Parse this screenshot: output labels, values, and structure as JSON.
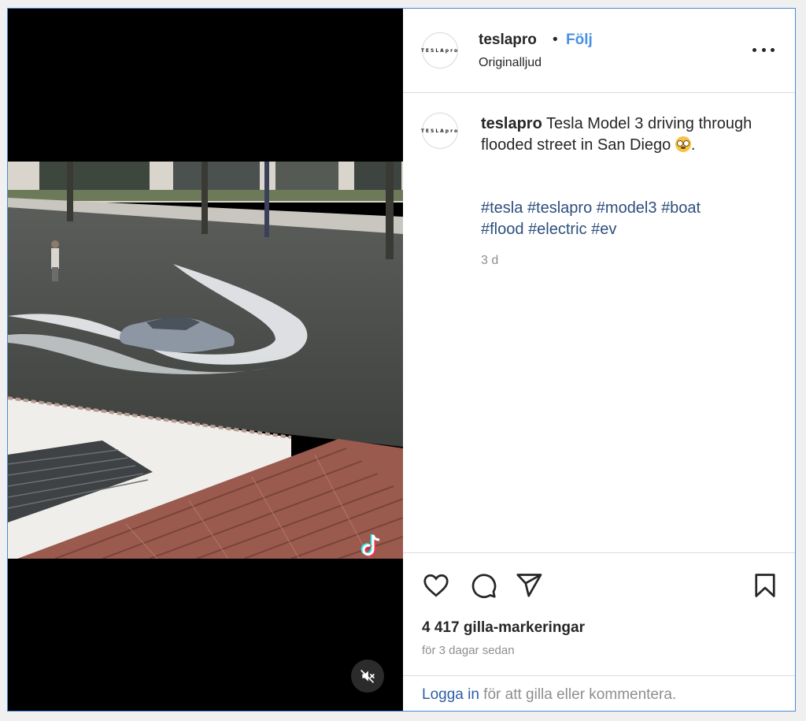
{
  "post": {
    "author": "teslapro",
    "avatar_text": "TESLApro",
    "separator": "•",
    "follow_label": "Följ",
    "audio_label": "Originalljud",
    "more_icon": "more-horizontal-icon"
  },
  "caption": {
    "author": "teslapro",
    "text": "Tesla Model 3 driving through flooded street in San Diego",
    "emoji": "flushed-face-emoji",
    "after_emoji": ".",
    "hashtags": [
      "#tesla",
      "#teslapro",
      "#model3",
      "#boat",
      "#flood",
      "#electric",
      "#ev"
    ],
    "time": "3 d"
  },
  "actions": {
    "like_icon": "heart-icon",
    "comment_icon": "comment-icon",
    "share_icon": "send-icon",
    "save_icon": "bookmark-icon"
  },
  "stats": {
    "likes": "4 417 gilla-markeringar",
    "date": "för 3 dagar sedan"
  },
  "footer": {
    "login_link": "Logga in",
    "login_text": " för att gilla eller kommentera."
  },
  "video": {
    "muted_icon": "speaker-muted-icon",
    "watermark": "tiktok-logo-icon"
  },
  "colors": {
    "link_blue": "#4a90e2",
    "hashtag_blue": "#2c4f7c",
    "text": "#262626",
    "muted": "#8e8e8e",
    "border": "#dbdbdb"
  }
}
